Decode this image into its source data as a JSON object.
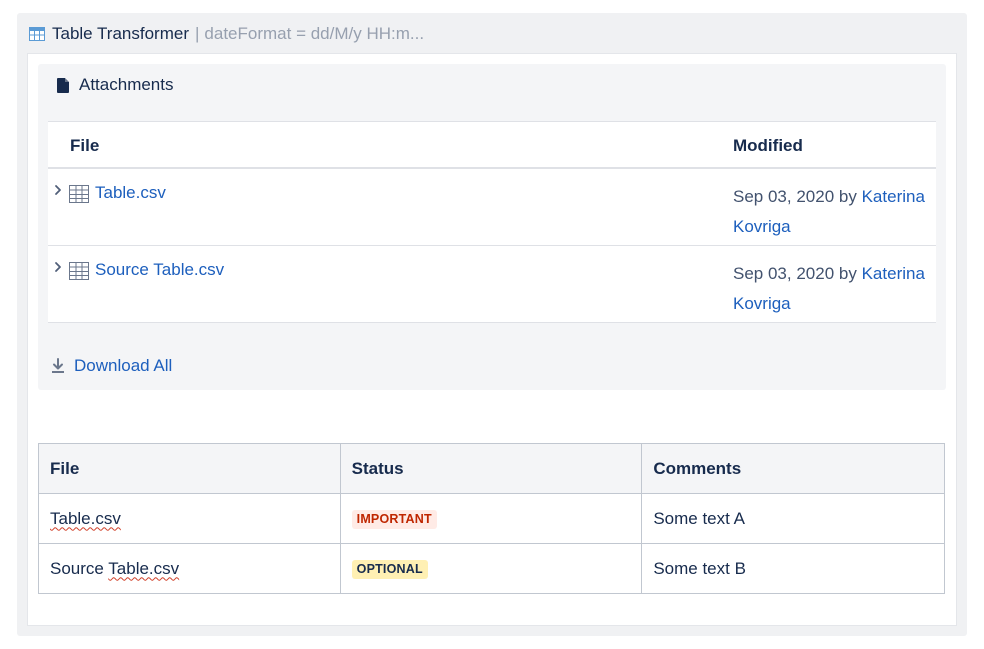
{
  "macro": {
    "name": "Table Transformer",
    "separator": "|",
    "params": "dateFormat = dd/M/y HH:m..."
  },
  "attachments": {
    "title": "Attachments",
    "columns": {
      "file": "File",
      "modified": "Modified"
    },
    "rows": [
      {
        "file": "Table.csv",
        "date": "Sep 03, 2020",
        "by": "by",
        "author": "Katerina Kovriga"
      },
      {
        "file": "Source Table.csv",
        "date": "Sep 03, 2020",
        "by": "by",
        "author": "Katerina Kovriga"
      }
    ],
    "download_all": "Download All"
  },
  "table": {
    "headers": [
      "File",
      "Status",
      "Comments"
    ],
    "rows": [
      {
        "file_prefix": "",
        "file_word": "Table.csv",
        "status": "IMPORTANT",
        "comment": "Some text A"
      },
      {
        "file_prefix": "Source ",
        "file_word": "Table.csv",
        "status": "OPTIONAL",
        "comment": "Some text B"
      }
    ]
  },
  "colors": {
    "link": "#1d5fbd",
    "important_bg": "#ffebe6",
    "important_text": "#bf2600",
    "optional_bg": "#fff0b3"
  },
  "icons": {
    "macro": "table-transformer-icon",
    "attachments": "document-icon",
    "row_toggle": "chevron-right-icon",
    "file_type": "spreadsheet-icon",
    "download": "download-icon"
  }
}
